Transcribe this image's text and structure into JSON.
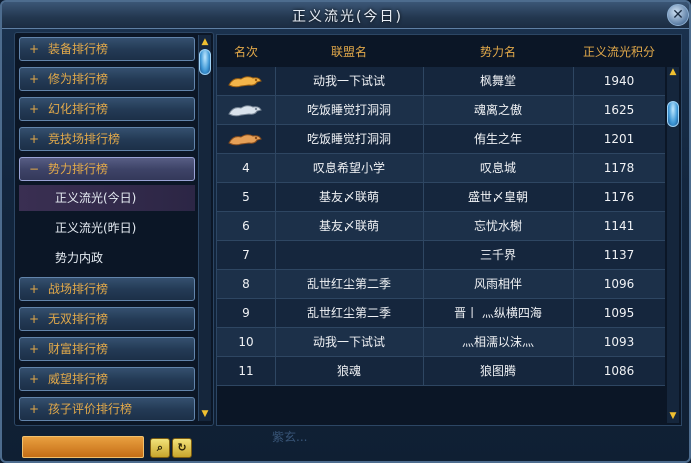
{
  "window": {
    "title": "正义流光(今日)",
    "close": "✕"
  },
  "sidebar": {
    "categories": [
      {
        "sign": "+",
        "label": "装备排行榜"
      },
      {
        "sign": "+",
        "label": "修为排行榜"
      },
      {
        "sign": "+",
        "label": "幻化排行榜"
      },
      {
        "sign": "+",
        "label": "竞技场排行榜"
      },
      {
        "sign": "−",
        "label": "势力排行榜"
      },
      {
        "sign": "+",
        "label": "战场排行榜"
      },
      {
        "sign": "+",
        "label": "无双排行榜"
      },
      {
        "sign": "+",
        "label": "财富排行榜"
      },
      {
        "sign": "+",
        "label": "威望排行榜"
      },
      {
        "sign": "+",
        "label": "孩子评价排行榜"
      }
    ],
    "subitems": [
      {
        "label": "正义流光(今日)"
      },
      {
        "label": "正义流光(昨日)"
      },
      {
        "label": "势力内政"
      }
    ]
  },
  "table": {
    "headers": [
      "名次",
      "联盟名",
      "势力名",
      "正义流光积分"
    ],
    "rows": [
      {
        "rank": "",
        "medal": "gold",
        "alliance": "动我一下试试",
        "faction": "枫舞堂",
        "score": "1940"
      },
      {
        "rank": "",
        "medal": "silver",
        "alliance": "吃饭睡觉打洞洞",
        "faction": "魂离之傲",
        "score": "1625"
      },
      {
        "rank": "",
        "medal": "bronze",
        "alliance": "吃饭睡觉打洞洞",
        "faction": "侑生之年",
        "score": "1201"
      },
      {
        "rank": "4",
        "medal": "",
        "alliance": "叹息希望小学",
        "faction": "叹息城",
        "score": "1178"
      },
      {
        "rank": "5",
        "medal": "",
        "alliance": "基友〆联萌",
        "faction": "盛世〆皇朝",
        "score": "1176"
      },
      {
        "rank": "6",
        "medal": "",
        "alliance": "基友〆联萌",
        "faction": "忘忧水榭",
        "score": "1141"
      },
      {
        "rank": "7",
        "medal": "",
        "alliance": "",
        "faction": "三千界",
        "score": "1137"
      },
      {
        "rank": "8",
        "medal": "",
        "alliance": "乱世红尘第二季",
        "faction": "风雨相伴",
        "score": "1096"
      },
      {
        "rank": "9",
        "medal": "",
        "alliance": "乱世红尘第二季",
        "faction": "晋丨 灬纵横四海",
        "score": "1095"
      },
      {
        "rank": "10",
        "medal": "",
        "alliance": "动我一下试试",
        "faction": "灬相濡以沫灬",
        "score": "1093"
      },
      {
        "rank": "11",
        "medal": "",
        "alliance": "狼魂",
        "faction": "狼图腾",
        "score": "1086"
      }
    ]
  },
  "footer": {
    "search_value": "",
    "search_icon": "magnifier-icon",
    "refresh_icon": "refresh-icon",
    "deco_text": "紫玄..."
  },
  "colors": {
    "accent": "#e2a94a",
    "text": "#f0f2f5",
    "row_odd": "#15263d",
    "row_even": "#1c3049"
  }
}
